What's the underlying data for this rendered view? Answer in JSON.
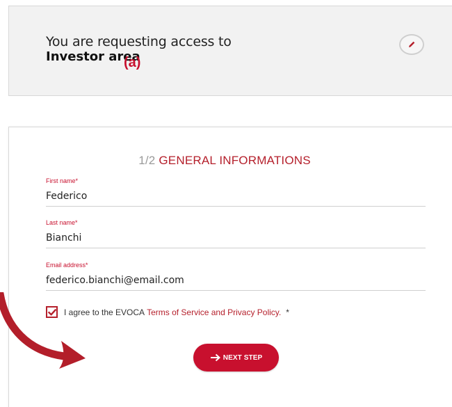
{
  "access": {
    "intro": "You are requesting access to",
    "area": "Investor area",
    "annotation": "(a)"
  },
  "form": {
    "step": "1/2",
    "title": "GENERAL INFORMATIONS",
    "first_name": {
      "label": "First name*",
      "value": "Federico"
    },
    "last_name": {
      "label": "Last name*",
      "value": "Bianchi"
    },
    "email": {
      "label": "Email address*",
      "value": "federico.bianchi@email.com"
    },
    "agree": {
      "checked": true,
      "text": "I agree to the EVOCA",
      "link": "Terms of Service and Privacy Policy.",
      "required": "*"
    },
    "next_button": {
      "label": "NEXT STEP",
      "icon": "arrow-right-icon"
    }
  },
  "icons": {
    "edit": "pencil-icon",
    "checkbox": "checkmark-icon",
    "pointer": "curved-arrow-icon"
  },
  "colors": {
    "accent": "#c8102e",
    "card_bg": "#f2f2f2",
    "title_red": "#b5202c"
  }
}
